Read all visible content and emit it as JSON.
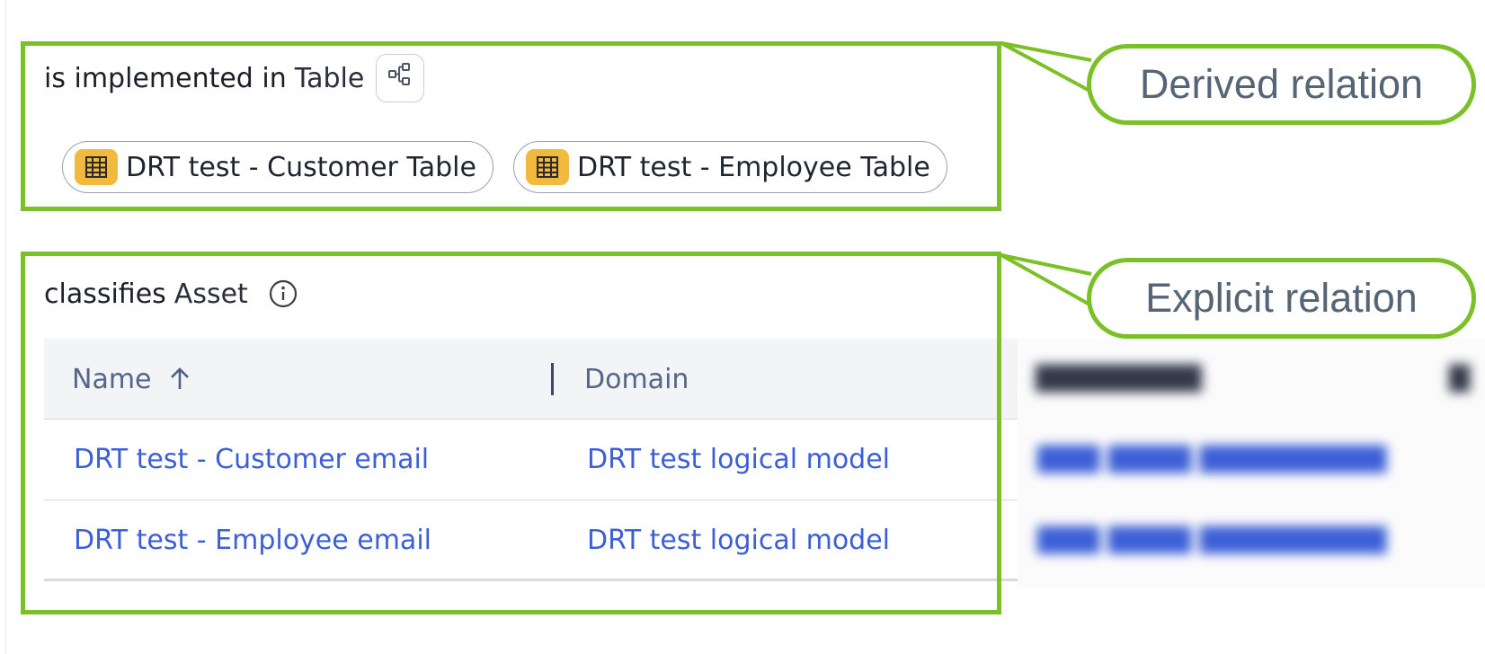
{
  "derived_section": {
    "relation_label": "is implemented in",
    "target_type": "Table",
    "graph_button_icon": "graph-view-icon",
    "chips": [
      {
        "label": "DRT test - Customer Table",
        "icon": "table-icon"
      },
      {
        "label": "DRT test - Employee Table",
        "icon": "table-icon"
      }
    ]
  },
  "explicit_section": {
    "relation_label": "classifies",
    "target_type": "Asset",
    "info_icon": "info-icon",
    "table": {
      "columns": [
        {
          "label": "Name",
          "sort": "ascending",
          "sort_icon": "arrow-up-icon"
        },
        {
          "label": "Domain"
        }
      ],
      "rows": [
        {
          "name": "DRT test - Customer email",
          "domain": "DRT test logical model"
        },
        {
          "name": "DRT test - Employee email",
          "domain": "DRT test logical model"
        }
      ]
    }
  },
  "annotations": {
    "derived": "Derived relation",
    "explicit": "Explicit relation"
  },
  "colors": {
    "annotation_border": "#7bc027",
    "link": "#3d5fd6",
    "chip_icon_bg": "#f1b93d",
    "header_bg": "#f3f4f6",
    "annotation_text": "#566575"
  }
}
